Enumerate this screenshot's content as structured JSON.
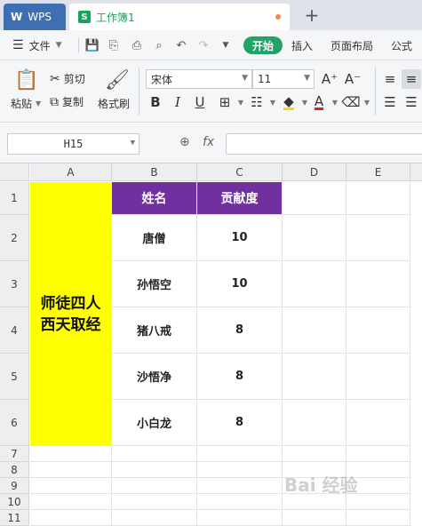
{
  "tabs": {
    "app_label": "WPS",
    "doc_label": "工作簿1",
    "doc_icon_letter": "S",
    "new_tab": "+"
  },
  "menu": {
    "file": "文件",
    "start": "开始",
    "insert": "插入",
    "page_layout": "页面布局",
    "formula": "公式"
  },
  "ribbon": {
    "paste": "粘贴",
    "cut": "剪切",
    "copy": "复制",
    "format_painter": "格式刷",
    "font_name": "宋体",
    "font_size": "11",
    "grow_font": "A⁺",
    "shrink_font": "A⁻",
    "bold": "B",
    "italic": "I",
    "underline": "U",
    "font_color_letter": "A"
  },
  "formula_bar": {
    "cell_ref": "H15",
    "fx": "fx",
    "value": ""
  },
  "sheet": {
    "columns": [
      "A",
      "B",
      "C",
      "D",
      "E"
    ],
    "rows": [
      "1",
      "2",
      "3",
      "4",
      "5",
      "6",
      "7",
      "8",
      "9",
      "10",
      "11"
    ],
    "merged_a_text": "师徒四人西天取经",
    "headers": [
      "姓名",
      "贡献度"
    ],
    "data": [
      {
        "name": "唐僧",
        "score": "10"
      },
      {
        "name": "孙悟空",
        "score": "10"
      },
      {
        "name": "猪八戒",
        "score": "8"
      },
      {
        "name": "沙悟净",
        "score": "8"
      },
      {
        "name": "小白龙",
        "score": "8"
      }
    ],
    "header_color": "#7030a0",
    "merged_color": "#ffff00"
  },
  "watermark": "Bai 经验"
}
